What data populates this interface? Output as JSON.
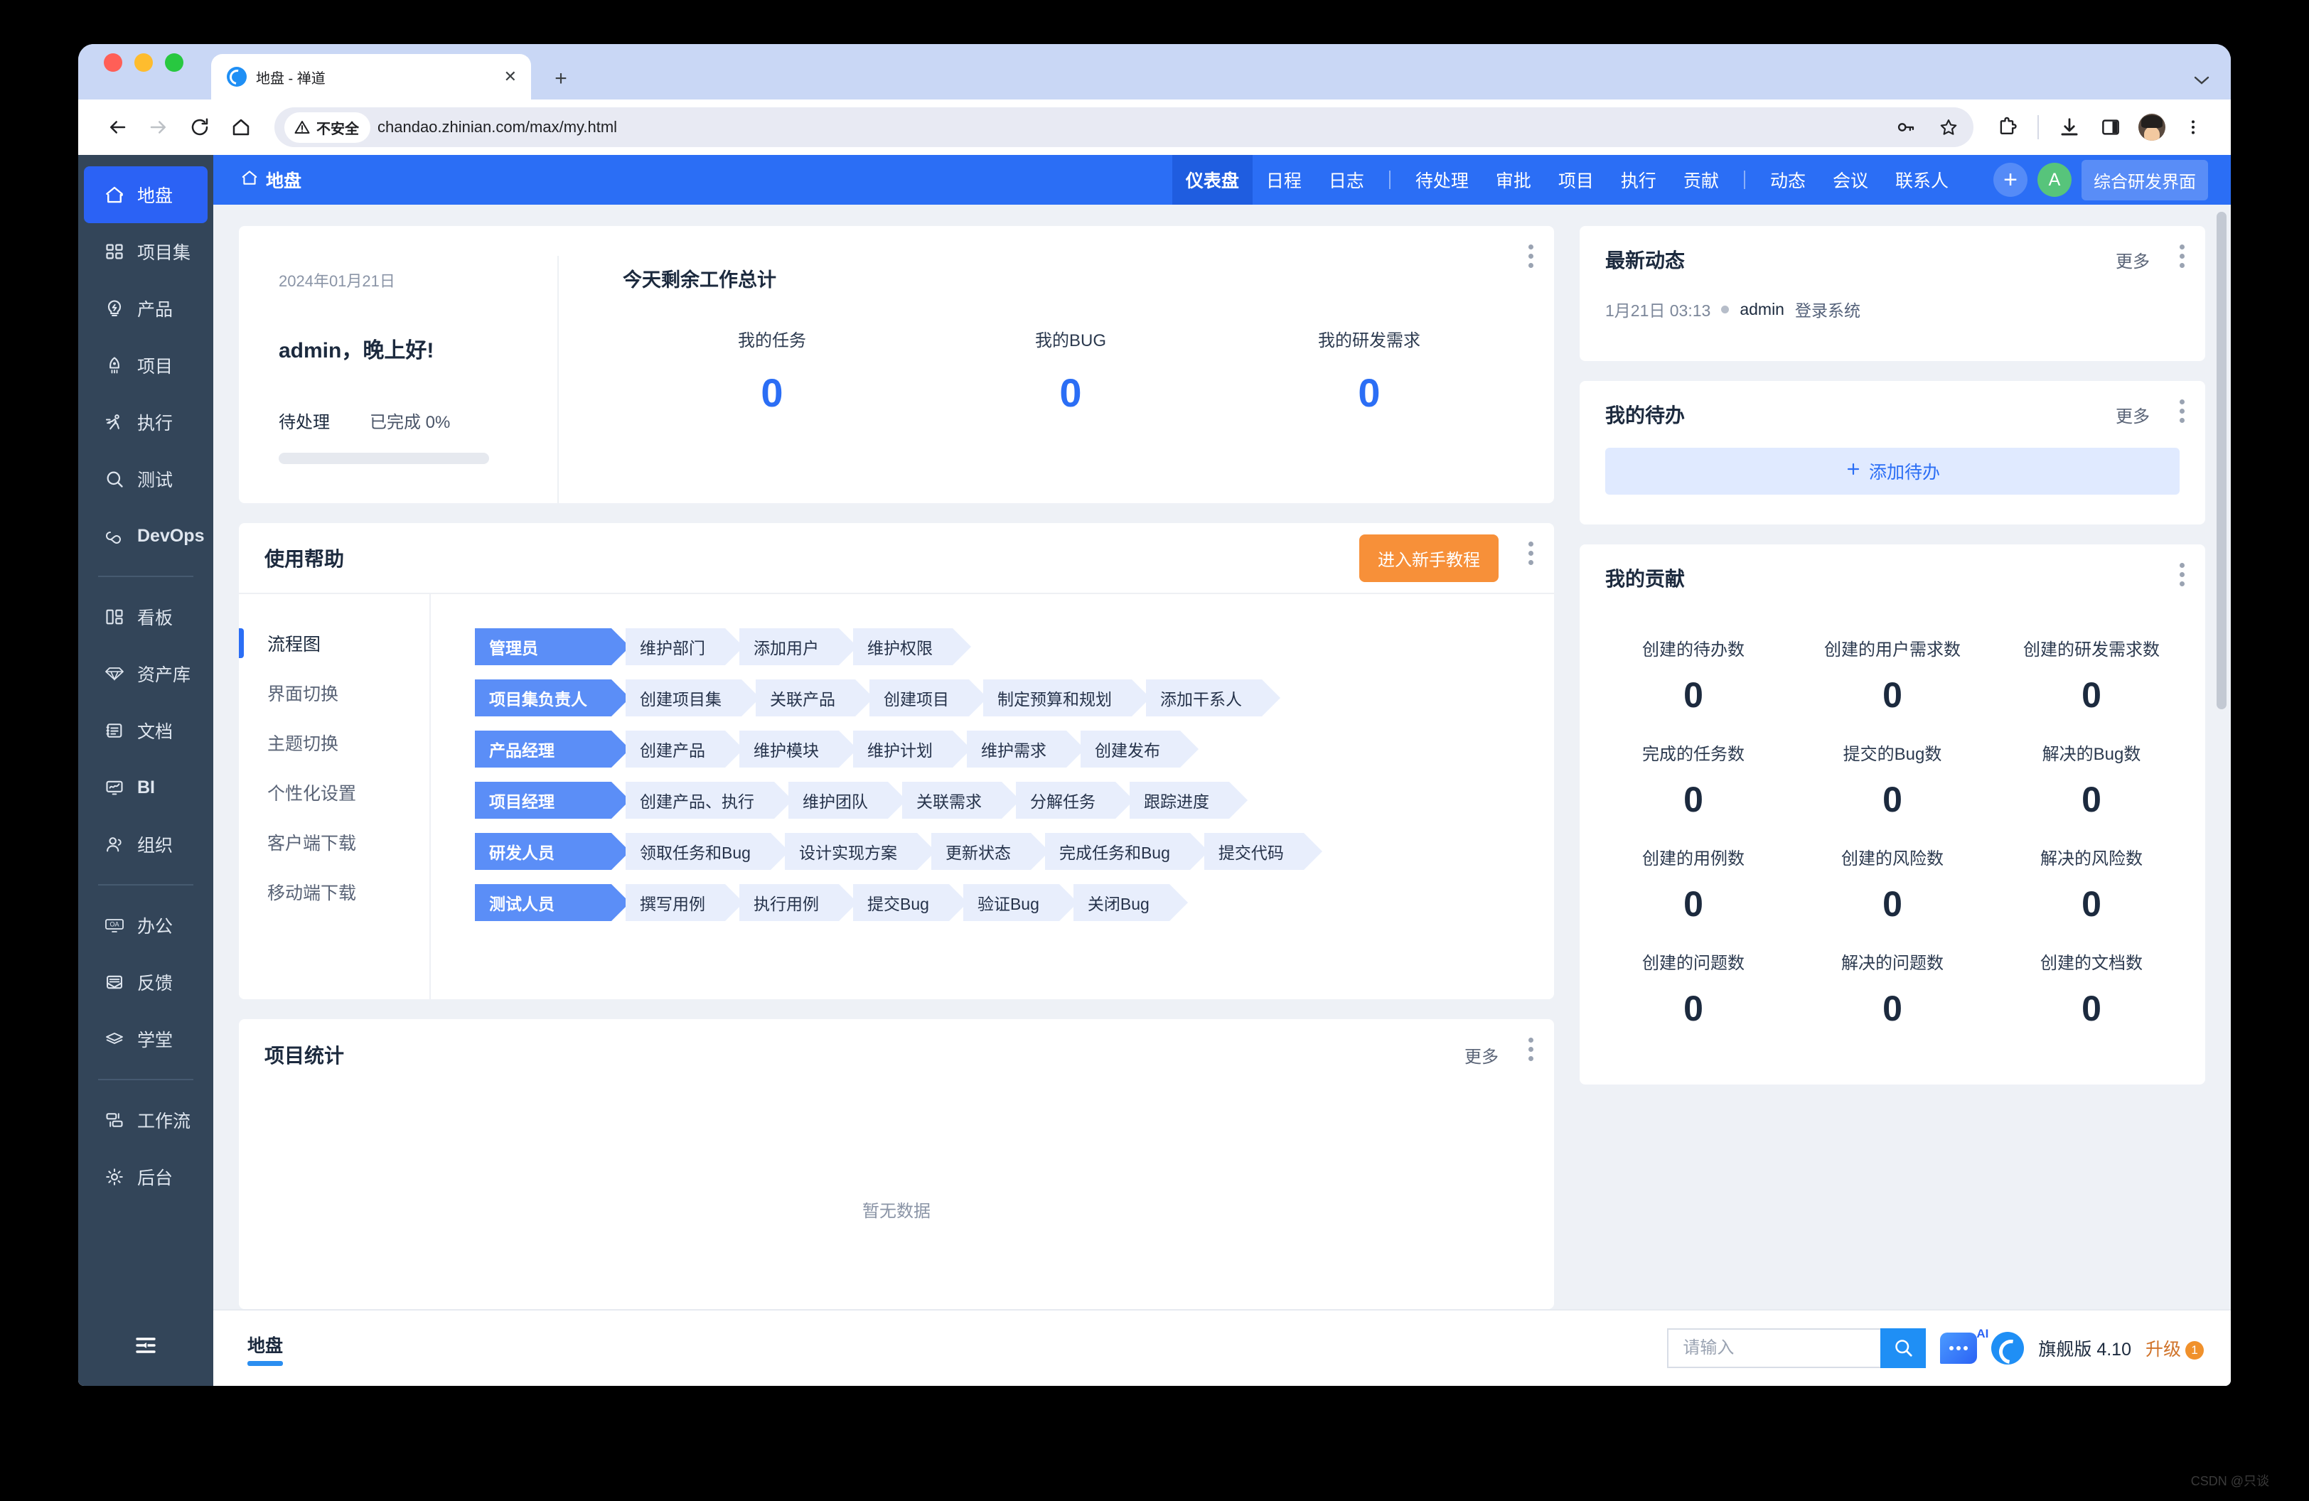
{
  "browser": {
    "tab_title": "地盘 - 禅道",
    "security_label": "不安全",
    "url": "chandao.zhinian.com/max/my.html",
    "new_tab_label": "+",
    "close_label": "✕"
  },
  "rail": {
    "items": [
      {
        "label": "地盘",
        "icon": "home-icon",
        "active": true
      },
      {
        "label": "项目集",
        "icon": "grid-icon",
        "active": false
      },
      {
        "label": "产品",
        "icon": "bulb-icon",
        "active": false
      },
      {
        "label": "项目",
        "icon": "rocket-icon",
        "active": false
      },
      {
        "label": "执行",
        "icon": "runner-icon",
        "active": false
      },
      {
        "label": "测试",
        "icon": "magnifier-icon",
        "active": false
      },
      {
        "label": "DevOps",
        "icon": "infinity-icon",
        "active": false
      }
    ],
    "items2": [
      {
        "label": "看板",
        "icon": "kanban-icon"
      },
      {
        "label": "资产库",
        "icon": "diamond-icon"
      },
      {
        "label": "文档",
        "icon": "document-icon"
      },
      {
        "label": "BI",
        "icon": "monitor-icon"
      },
      {
        "label": "组织",
        "icon": "people-icon"
      }
    ],
    "items3": [
      {
        "label": "办公",
        "icon": "oa-icon"
      },
      {
        "label": "反馈",
        "icon": "envelope-icon"
      },
      {
        "label": "学堂",
        "icon": "book-icon"
      }
    ],
    "items4": [
      {
        "label": "工作流",
        "icon": "workflow-icon"
      },
      {
        "label": "后台",
        "icon": "gear-icon"
      }
    ],
    "collapse_icon": "collapse-menu-icon"
  },
  "topnav": {
    "brand": "地盘",
    "tabs_group1": [
      {
        "label": "仪表盘",
        "active": true
      },
      {
        "label": "日程",
        "active": false
      },
      {
        "label": "日志",
        "active": false
      }
    ],
    "tabs_group2": [
      {
        "label": "待处理",
        "active": false
      },
      {
        "label": "审批",
        "active": false
      },
      {
        "label": "项目",
        "active": false
      },
      {
        "label": "执行",
        "active": false
      },
      {
        "label": "贡献",
        "active": false
      }
    ],
    "tabs_group3": [
      {
        "label": "动态",
        "active": false
      },
      {
        "label": "会议",
        "active": false
      },
      {
        "label": "联系人",
        "active": false
      }
    ],
    "plus_label": "+",
    "avatar_letter": "A",
    "mode_chip": "综合研发界面"
  },
  "welcome": {
    "date": "2024年01月21日",
    "greeting": "admin，晚上好!",
    "pending_label": "待处理",
    "completed_label": "已完成 0%",
    "title": "今天剩余工作总计",
    "stats": [
      {
        "label": "我的任务",
        "value": "0"
      },
      {
        "label": "我的BUG",
        "value": "0"
      },
      {
        "label": "我的研发需求",
        "value": "0"
      }
    ]
  },
  "help": {
    "title": "使用帮助",
    "tutorial_button": "进入新手教程",
    "nav": [
      {
        "label": "流程图",
        "active": true
      },
      {
        "label": "界面切换",
        "active": false
      },
      {
        "label": "主题切换",
        "active": false
      },
      {
        "label": "个性化设置",
        "active": false
      },
      {
        "label": "客户端下载",
        "active": false
      },
      {
        "label": "移动端下载",
        "active": false
      }
    ],
    "flow_rows": [
      {
        "role": "管理员",
        "steps": [
          "维护部门",
          "添加用户",
          "维护权限"
        ]
      },
      {
        "role": "项目集负责人",
        "steps": [
          "创建项目集",
          "关联产品",
          "创建项目",
          "制定预算和规划",
          "添加干系人"
        ]
      },
      {
        "role": "产品经理",
        "steps": [
          "创建产品",
          "维护模块",
          "维护计划",
          "维护需求",
          "创建发布"
        ]
      },
      {
        "role": "项目经理",
        "steps": [
          "创建产品、执行",
          "维护团队",
          "关联需求",
          "分解任务",
          "跟踪进度"
        ]
      },
      {
        "role": "研发人员",
        "steps": [
          "领取任务和Bug",
          "设计实现方案",
          "更新状态",
          "完成任务和Bug",
          "提交代码"
        ]
      },
      {
        "role": "测试人员",
        "steps": [
          "撰写用例",
          "执行用例",
          "提交Bug",
          "验证Bug",
          "关闭Bug"
        ]
      }
    ]
  },
  "project_stats": {
    "title": "项目统计",
    "more": "更多",
    "empty": "暂无数据"
  },
  "latest": {
    "title": "最新动态",
    "more": "更多",
    "items": [
      {
        "time": "1月21日 03:13",
        "user": "admin",
        "action": "登录系统"
      }
    ]
  },
  "todo": {
    "title": "我的待办",
    "more": "更多",
    "add_label": "添加待办",
    "add_icon": "plus-icon"
  },
  "contribution": {
    "title": "我的贡献",
    "cells": [
      {
        "label": "创建的待办数",
        "value": "0"
      },
      {
        "label": "创建的用户需求数",
        "value": "0"
      },
      {
        "label": "创建的研发需求数",
        "value": "0"
      },
      {
        "label": "完成的任务数",
        "value": "0"
      },
      {
        "label": "提交的Bug数",
        "value": "0"
      },
      {
        "label": "解决的Bug数",
        "value": "0"
      },
      {
        "label": "创建的用例数",
        "value": "0"
      },
      {
        "label": "创建的风险数",
        "value": "0"
      },
      {
        "label": "解决的风险数",
        "value": "0"
      },
      {
        "label": "创建的问题数",
        "value": "0"
      },
      {
        "label": "解决的问题数",
        "value": "0"
      },
      {
        "label": "创建的文档数",
        "value": "0"
      }
    ]
  },
  "statusbar": {
    "tab_label": "地盘",
    "search_placeholder": "请输入",
    "search_value": "",
    "version": "旗舰版 4.10",
    "upgrade": "升级",
    "badge": "1"
  },
  "watermark": "CSDN @只谈"
}
